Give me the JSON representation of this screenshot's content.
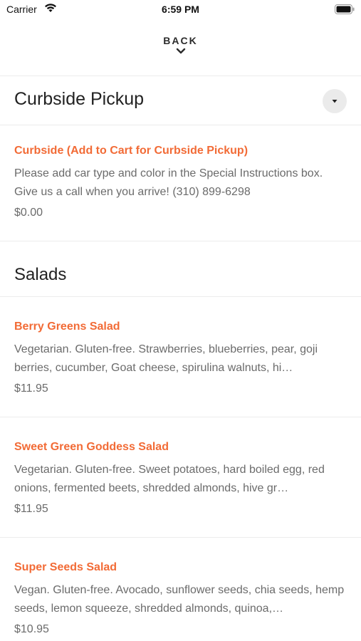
{
  "status_bar": {
    "carrier": "Carrier",
    "time": "6:59 PM",
    "wifi_icon": "wifi-icon",
    "battery_icon": "battery-icon"
  },
  "nav": {
    "back_label": "BACK",
    "back_icon": "chevron-down-icon"
  },
  "sections": [
    {
      "title": "Curbside Pickup",
      "dropdown_icon": "caret-down-icon",
      "items": [
        {
          "name": "Curbside (Add to Cart for Curbside Pickup)",
          "description": "Please add car type and color in the Special Instructions box. Give us a call when you arrive! (310) 899-6298",
          "price": "$0.00"
        }
      ]
    },
    {
      "title": "Salads",
      "items": [
        {
          "name": "Berry Greens Salad",
          "description": "Vegetarian. Gluten-free. Strawberries, blueberries, pear, goji berries, cucumber, Goat cheese, spirulina walnuts, hi…",
          "price": "$11.95"
        },
        {
          "name": "Sweet Green Goddess Salad",
          "description": "Vegetarian. Gluten-free. Sweet potatoes, hard boiled egg, red onions, fermented beets, shredded almonds, hive gr…",
          "price": "$11.95"
        },
        {
          "name": "Super Seeds Salad",
          "description": "Vegan. Gluten-free. Avocado, sunflower seeds, chia seeds, hemp seeds, lemon squeeze, shredded almonds, quinoa,…",
          "price": "$10.95"
        }
      ]
    }
  ],
  "colors": {
    "accent": "#f26b36",
    "text": "#2b2b2b",
    "muted": "#6b6b6b",
    "divider": "#ececec"
  }
}
